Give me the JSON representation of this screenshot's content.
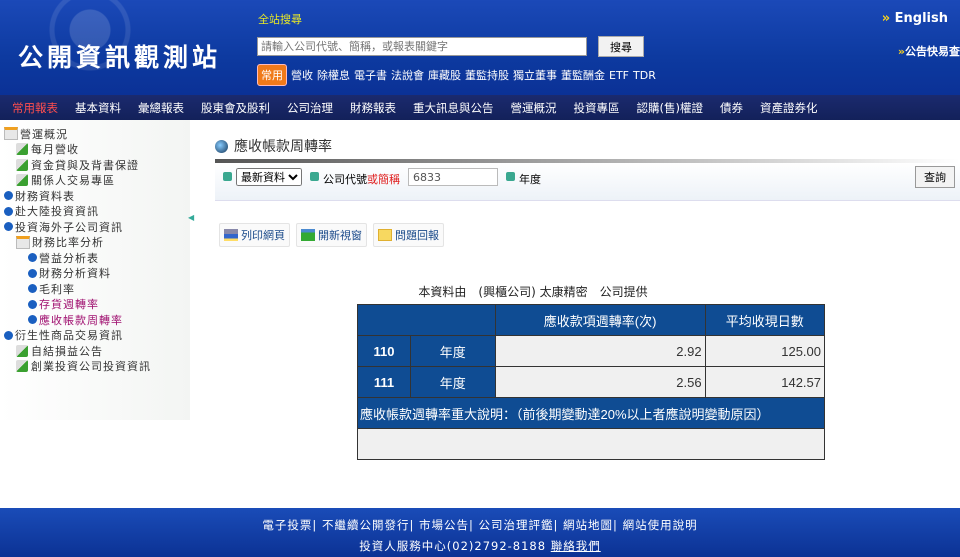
{
  "header": {
    "logo": "公開資訊觀測站",
    "search_label": "全站搜尋",
    "search_placeholder": "請輸入公司代號、簡稱，或報表關鍵字",
    "search_button": "搜尋",
    "quick_badge": "常用",
    "quick_links": [
      "營收",
      "除權息",
      "電子書",
      "法說會",
      "庫藏股",
      "董監持股",
      "獨立董事",
      "董監酬金",
      "ETF",
      "TDR"
    ],
    "english": "English",
    "express": "公告快易查"
  },
  "nav": [
    "常用報表",
    "基本資料",
    "彙總報表",
    "股東會及股利",
    "公司治理",
    "財務報表",
    "重大訊息與公告",
    "營運概況",
    "投資專區",
    "認購(售)權證",
    "債券",
    "資產證券化"
  ],
  "sidebar": [
    {
      "label": "營運概況",
      "icon": "folder-icon",
      "indent": 0
    },
    {
      "label": "每月營收",
      "icon": "download-arrow-icon",
      "indent": 1
    },
    {
      "label": "資金貸與及背書保證",
      "icon": "download-arrow-icon",
      "indent": 1
    },
    {
      "label": "關係人交易專區",
      "icon": "download-arrow-icon",
      "indent": 1
    },
    {
      "label": "財務資料表",
      "icon": "bullet-icon",
      "indent": 0
    },
    {
      "label": "赴大陸投資資訊",
      "icon": "bullet-icon",
      "indent": 0
    },
    {
      "label": "投資海外子公司資訊",
      "icon": "bullet-icon",
      "indent": 0
    },
    {
      "label": "財務比率分析",
      "icon": "folder-icon",
      "indent": 1
    },
    {
      "label": "營益分析表",
      "icon": "bullet-icon",
      "indent": 2
    },
    {
      "label": "財務分析資料",
      "icon": "bullet-icon",
      "indent": 2
    },
    {
      "label": "毛利率",
      "icon": "bullet-icon",
      "indent": 2
    },
    {
      "label": "存貨週轉率",
      "icon": "bullet-icon",
      "indent": 2,
      "visited": true
    },
    {
      "label": "應收帳款周轉率",
      "icon": "bullet-icon",
      "indent": 2,
      "visited": true
    },
    {
      "label": "衍生性商品交易資訊",
      "icon": "bullet-icon",
      "indent": 0
    },
    {
      "label": "自結損益公告",
      "icon": "download-arrow-icon",
      "indent": 1
    },
    {
      "label": "創業投資公司投資資訊",
      "icon": "download-arrow-icon",
      "indent": 1
    }
  ],
  "main": {
    "title": "應收帳款周轉率",
    "select_value": "最新資料",
    "code_label": "公司代號",
    "or_label": "或簡稱",
    "code_value": "6833",
    "year_label": "年度",
    "query_button": "查詢",
    "tools": [
      "列印網頁",
      "開新視窗",
      "問題回報"
    ],
    "provider": "本資料由　(興櫃公司) 太康精密　公司提供",
    "table": {
      "headers": [
        "應收款項週轉率(次)",
        "平均收現日數"
      ],
      "rows": [
        {
          "year": "110",
          "unit": "年度",
          "turnover": "2.92",
          "days": "125.00"
        },
        {
          "year": "111",
          "unit": "年度",
          "turnover": "2.56",
          "days": "142.57"
        }
      ],
      "note": "應收帳款週轉率重大說明：（前後期變動達20%以上者應說明變動原因）"
    }
  },
  "footer": {
    "links": [
      "電子投票",
      "不繼續公開發行",
      "市場公告",
      "公司治理評鑑",
      "網站地圖",
      "網站使用說明"
    ],
    "service": "投資人服務中心(02)2792-8188",
    "contact": "聯絡我們"
  },
  "colors": {
    "header_blue": "#0d3aa0",
    "nav": "#1b2a6e",
    "table_header": "#0f4c93",
    "active_nav": "#ff4e4e"
  }
}
